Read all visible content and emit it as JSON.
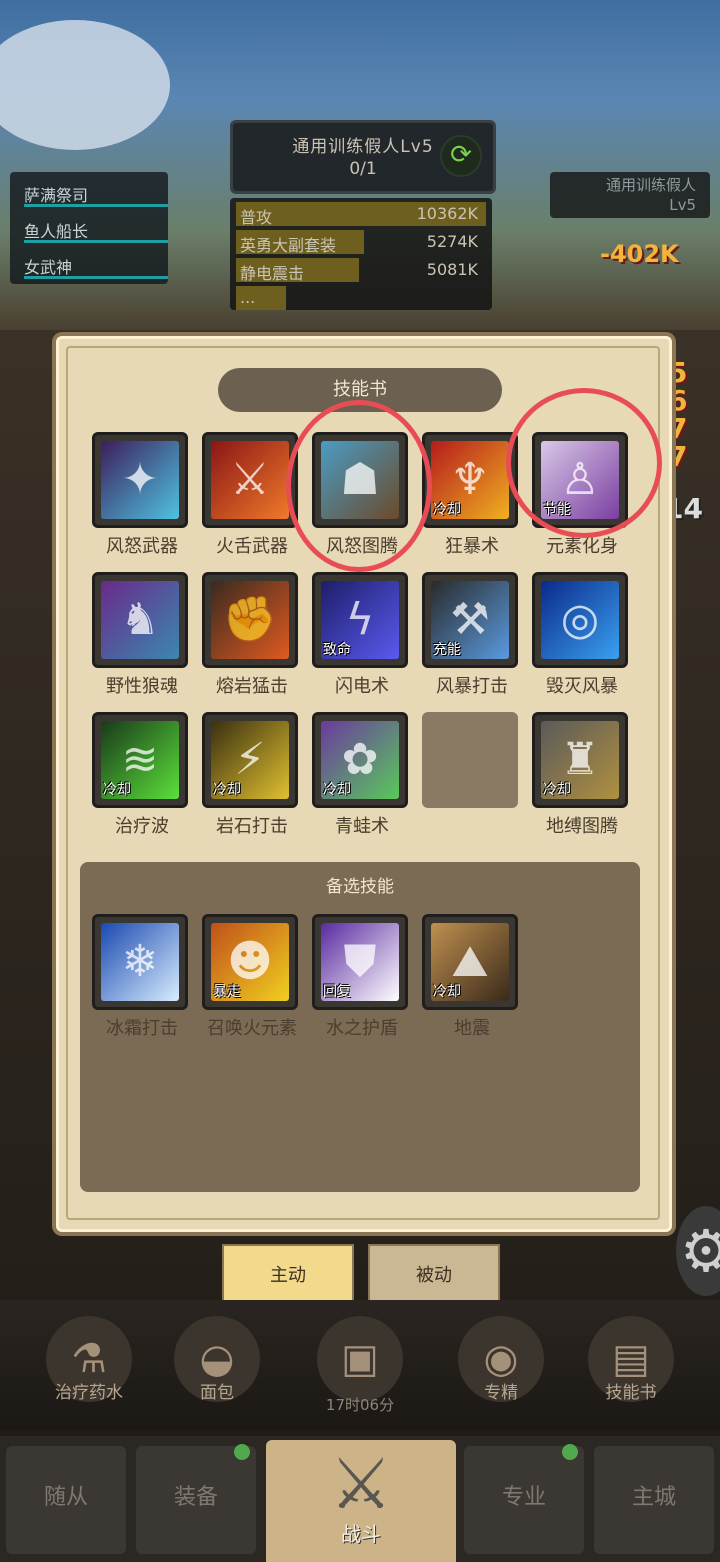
{
  "boss": {
    "name": "通用训练假人Lv5",
    "count": "0/1",
    "refresh_icon": "refresh-icon"
  },
  "party": [
    "萨满祭司",
    "鱼人船长",
    "女武神"
  ],
  "damage": {
    "rows": [
      {
        "name": "普攻",
        "value": "10362K",
        "fill_fraction": 1.0
      },
      {
        "name": "英勇大副套装",
        "value": "5274K",
        "fill_fraction": 0.51
      },
      {
        "name": "静电震击",
        "value": "5081K",
        "fill_fraction": 0.49
      },
      {
        "name": "...",
        "value": "",
        "fill_fraction": 0.2
      }
    ]
  },
  "target": {
    "line1": "通用训练假人",
    "line2": "Lv5"
  },
  "floating_numbers": [
    "-402K",
    "5",
    "6",
    "7",
    "7",
    "14"
  ],
  "panel_title": "技能书",
  "equipped_skills": [
    {
      "name": "风怒武器",
      "tag": "",
      "icon": "claw-weapon-icon",
      "colors": [
        "#3d1e5c",
        "#4ec3e0"
      ],
      "glyph": "✦"
    },
    {
      "name": "火舌武器",
      "tag": "",
      "icon": "fire-axe-icon",
      "colors": [
        "#8a1616",
        "#f07a2a"
      ],
      "glyph": "⚔"
    },
    {
      "name": "风怒图腾",
      "tag": "",
      "icon": "totem-icon",
      "colors": [
        "#4a9cc4",
        "#6b4a2a"
      ],
      "glyph": "☗"
    },
    {
      "name": "狂暴术",
      "tag": "冷却",
      "icon": "mask-icon",
      "colors": [
        "#b51c1c",
        "#f0b020"
      ],
      "glyph": "♆"
    },
    {
      "name": "元素化身",
      "tag": "节能",
      "icon": "figure-icon",
      "colors": [
        "#d8c8e8",
        "#7b3fa0"
      ],
      "glyph": "♙"
    },
    {
      "name": "野性狼魂",
      "tag": "",
      "icon": "wolf-icon",
      "colors": [
        "#6a2a8a",
        "#3a88b0"
      ],
      "glyph": "♞"
    },
    {
      "name": "熔岩猛击",
      "tag": "",
      "icon": "lava-fist-icon",
      "colors": [
        "#3a2a20",
        "#e05a20"
      ],
      "glyph": "✊"
    },
    {
      "name": "闪电术",
      "tag": "致命",
      "icon": "lightning-icon",
      "colors": [
        "#1e1e6a",
        "#5a5af0"
      ],
      "glyph": "ϟ"
    },
    {
      "name": "风暴打击",
      "tag": "充能",
      "icon": "hammer-icon",
      "colors": [
        "#2a2a2a",
        "#5a9ae0"
      ],
      "glyph": "⚒"
    },
    {
      "name": "毁灭风暴",
      "tag": "",
      "icon": "vortex-icon",
      "colors": [
        "#0a2a8a",
        "#3aa0f0"
      ],
      "glyph": "◎"
    },
    {
      "name": "治疗波",
      "tag": "冷却",
      "icon": "heal-wave-icon",
      "colors": [
        "#1a3a1a",
        "#5ae03a"
      ],
      "glyph": "≋"
    },
    {
      "name": "岩石打击",
      "tag": "冷却",
      "icon": "rock-strike-icon",
      "colors": [
        "#3a3010",
        "#e0c030"
      ],
      "glyph": "⚡"
    },
    {
      "name": "青蛙术",
      "tag": "冷却",
      "icon": "frog-icon",
      "colors": [
        "#6a3aa0",
        "#5ac85a"
      ],
      "glyph": "✿"
    },
    {
      "name": "",
      "tag": "",
      "icon": "empty-slot",
      "colors": [
        "#8a7a64",
        "#8a7a64"
      ],
      "glyph": ""
    },
    {
      "name": "地缚图腾",
      "tag": "冷却",
      "icon": "earth-totem-icon",
      "colors": [
        "#5a5a5a",
        "#b09040"
      ],
      "glyph": "♜"
    }
  ],
  "spare_title": "备选技能",
  "spare_skills": [
    {
      "name": "冰霜打击",
      "tag": "",
      "icon": "frost-icon",
      "colors": [
        "#1a4ab0",
        "#d8ecff"
      ],
      "glyph": "❄"
    },
    {
      "name": "召唤火元素",
      "tag": "暴走",
      "icon": "fire-elemental-icon",
      "colors": [
        "#c0501a",
        "#f0d020"
      ],
      "glyph": "☻"
    },
    {
      "name": "水之护盾",
      "tag": "回复",
      "icon": "shield-icon",
      "colors": [
        "#5a2aa0",
        "#ffffff"
      ],
      "glyph": "⛊"
    },
    {
      "name": "地震",
      "tag": "冷却",
      "icon": "earthquake-icon",
      "colors": [
        "#c09050",
        "#3a2a1a"
      ],
      "glyph": "⛰"
    }
  ],
  "tabs": {
    "active": "主动",
    "passive": "被动"
  },
  "hotbar": [
    {
      "label": "治疗药水",
      "icon": "potion-icon",
      "glyph": "⚗"
    },
    {
      "label": "面包",
      "icon": "bread-icon",
      "glyph": "◒"
    },
    {
      "label": "",
      "icon": "chest-icon",
      "glyph": "▣"
    },
    {
      "label": "专精",
      "icon": "target-icon",
      "glyph": "◉"
    },
    {
      "label": "技能书",
      "icon": "book-icon",
      "glyph": "▤"
    }
  ],
  "timer": "17时06分",
  "nav": {
    "followers": "随从",
    "equipment": "装备",
    "battle": "战斗",
    "profession": "专业",
    "city": "主城"
  }
}
